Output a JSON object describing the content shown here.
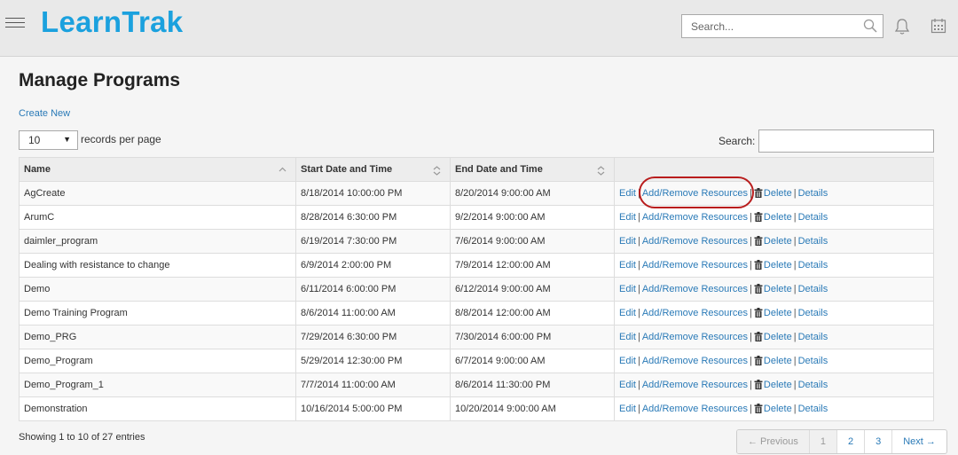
{
  "app": {
    "logo": "LearnTrak"
  },
  "header": {
    "search_placeholder": "Search..."
  },
  "page": {
    "title": "Manage Programs",
    "create_new": "Create New"
  },
  "length": {
    "value": "10",
    "label": "records per page"
  },
  "filter": {
    "label": "Search:",
    "value": ""
  },
  "table": {
    "columns": [
      "Name",
      "Start Date and Time",
      "End Date and Time",
      ""
    ],
    "rows": [
      {
        "name": "AgCreate",
        "start": "8/18/2014 10:00:00 PM",
        "end": "8/20/2014 9:00:00 AM"
      },
      {
        "name": "ArumC",
        "start": "8/28/2014 6:30:00 PM",
        "end": "9/2/2014 9:00:00 AM"
      },
      {
        "name": "daimler_program",
        "start": "6/19/2014 7:30:00 PM",
        "end": "7/6/2014 9:00:00 AM"
      },
      {
        "name": "Dealing with resistance to change",
        "start": "6/9/2014 2:00:00 PM",
        "end": "7/9/2014 12:00:00 AM"
      },
      {
        "name": "Demo",
        "start": "6/11/2014 6:00:00 PM",
        "end": "6/12/2014 9:00:00 AM"
      },
      {
        "name": "Demo Training Program",
        "start": "8/6/2014 11:00:00 AM",
        "end": "8/8/2014 12:00:00 AM"
      },
      {
        "name": "Demo_PRG",
        "start": "7/29/2014 6:30:00 PM",
        "end": "7/30/2014 6:00:00 PM"
      },
      {
        "name": "Demo_Program",
        "start": "5/29/2014 12:30:00 PM",
        "end": "6/7/2014 9:00:00 AM"
      },
      {
        "name": "Demo_Program_1",
        "start": "7/7/2014 11:00:00 AM",
        "end": "8/6/2014 11:30:00 PM"
      },
      {
        "name": "Demonstration",
        "start": "10/16/2014 5:00:00 PM",
        "end": "10/20/2014 9:00:00 AM"
      }
    ],
    "actions": {
      "edit": "Edit",
      "resources": "Add/Remove Resources",
      "delete": "Delete",
      "details": "Details",
      "separator": "|"
    }
  },
  "info": "Showing 1 to 10 of 27 entries",
  "pagination": {
    "previous": "← Previous",
    "pages": [
      "1",
      "2",
      "3"
    ],
    "next": "Next →",
    "current": "1"
  },
  "colors": {
    "brand": "#1ba1de",
    "link": "#2a7ab7",
    "highlight": "#b91d1d"
  }
}
